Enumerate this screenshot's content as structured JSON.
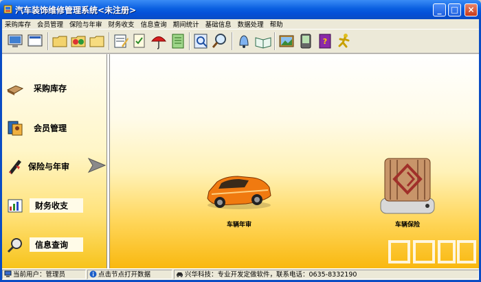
{
  "window": {
    "title": "汽车装饰维修管理系统<未注册>",
    "buttons": [
      "_",
      "□",
      "×"
    ]
  },
  "menubar": {
    "items": [
      "采购库存",
      "会员管理",
      "保险与年审",
      "财务收支",
      "信息查询",
      "期间统计",
      "基础信息",
      "数据处理",
      "帮助"
    ]
  },
  "toolbar": {
    "icons": [
      "monitor-icon",
      "monitor-window-icon",
      "folder-icon",
      "folder-swap-icon",
      "folder-plain-icon",
      "calendar-edit-icon",
      "document-check-icon",
      "umbrella-icon",
      "notebook-icon",
      "magnifier-document-icon",
      "search-icon",
      "bell-icon",
      "open-book-icon",
      "picture-icon",
      "pda-icon",
      "purple-book-icon",
      "runner-icon"
    ]
  },
  "leftnav": {
    "items": [
      {
        "label": "采购库存",
        "icon": "package-icon"
      },
      {
        "label": "会员管理",
        "icon": "member-icon"
      },
      {
        "label": "保险与年审",
        "icon": "pen-icon"
      },
      {
        "label": "财务收支",
        "icon": "chart-icon"
      },
      {
        "label": "信息查询",
        "icon": "magnifier-icon"
      }
    ],
    "selected_index": 2
  },
  "main": {
    "nodes": [
      {
        "label": "车辆年审",
        "icon": "car-icon"
      },
      {
        "label": "车辆保险",
        "icon": "safe-box-icon"
      }
    ]
  },
  "statusbar": {
    "user": "当前用户：管理员",
    "hint": "点击节点打开数据",
    "company": "兴华科技：专业开发定做软件，联系电话：0635-8332190"
  },
  "colors": {
    "title_blue": "#0a5fe0",
    "nav_gradient_end": "#f7c31b",
    "main_gradient_end": "#f9b80f"
  }
}
